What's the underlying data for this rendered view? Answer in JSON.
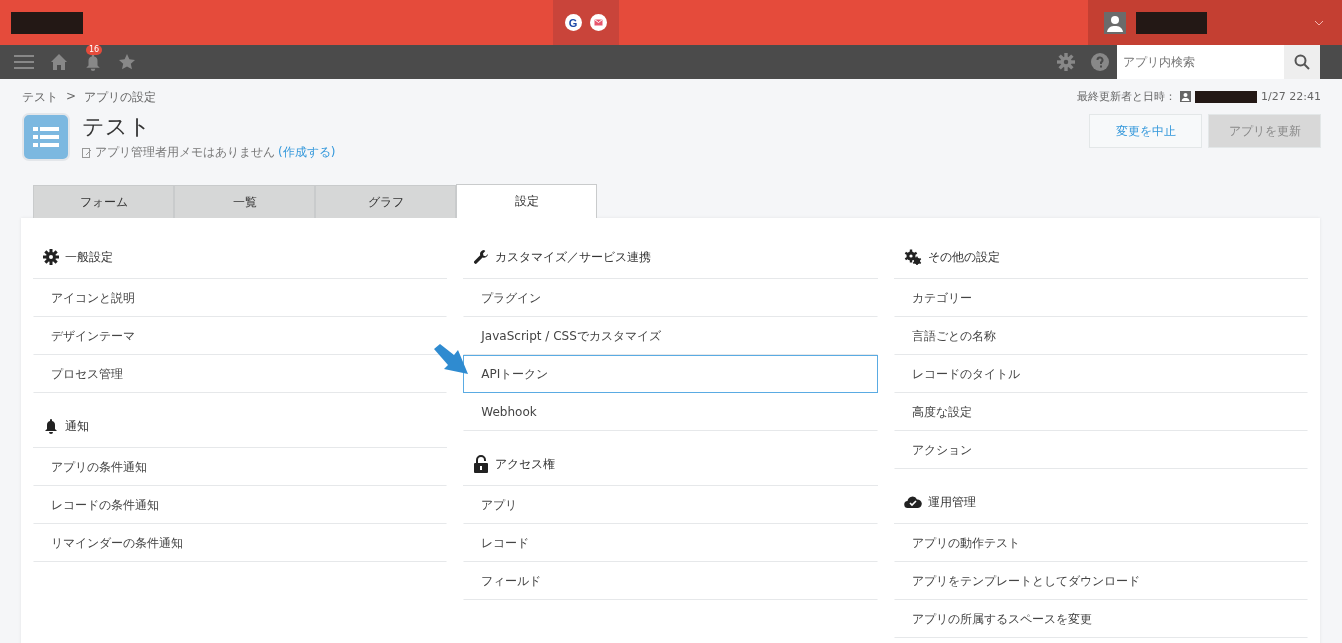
{
  "header": {
    "logo_redacted": true,
    "g_badge": "G",
    "user_redacted": true
  },
  "toolbar": {
    "notification_count": "16",
    "search": {
      "placeholder": "アプリ内検索"
    }
  },
  "breadcrumb": [
    "テスト",
    "アプリの設定"
  ],
  "breadcrumb_separator": ">",
  "app": {
    "title": "テスト",
    "memo": "アプリ管理者用メモはありません",
    "memo_link": "(作成する)"
  },
  "last_updated": {
    "label": "最終更新者と日時：",
    "time": "1/27 22:41"
  },
  "buttons": [
    {
      "label": "変更を中止",
      "kind": "secondary"
    },
    {
      "label": "アプリを更新",
      "kind": "disabled"
    }
  ],
  "tabs": [
    {
      "label": "フォーム",
      "selected": false
    },
    {
      "label": "一覧",
      "selected": false
    },
    {
      "label": "グラフ",
      "selected": false
    },
    {
      "label": "設定",
      "selected": true
    }
  ],
  "columns": [
    {
      "sections": [
        {
          "title": "一般設定",
          "items": [
            {
              "label": "アイコンと説明",
              "selected": false
            },
            {
              "label": "デザインテーマ",
              "selected": false
            },
            {
              "label": "プロセス管理",
              "selected": false
            }
          ]
        },
        {
          "title": "通知",
          "items": [
            {
              "label": "アプリの条件通知",
              "selected": false
            },
            {
              "label": "レコードの条件通知",
              "selected": false
            },
            {
              "label": "リマインダーの条件通知",
              "selected": false
            }
          ]
        }
      ]
    },
    {
      "sections": [
        {
          "title": "カスタマイズ／サービス連携",
          "items": [
            {
              "label": "プラグイン",
              "selected": false
            },
            {
              "label": "JavaScript / CSSでカスタマイズ",
              "selected": false
            },
            {
              "label": "APIトークン",
              "selected": true
            },
            {
              "label": "Webhook",
              "selected": false
            }
          ]
        },
        {
          "title": "アクセス権",
          "items": [
            {
              "label": "アプリ",
              "selected": false
            },
            {
              "label": "レコード",
              "selected": false
            },
            {
              "label": "フィールド",
              "selected": false
            }
          ]
        }
      ]
    },
    {
      "sections": [
        {
          "title": "その他の設定",
          "items": [
            {
              "label": "カテゴリー",
              "selected": false
            },
            {
              "label": "言語ごとの名称",
              "selected": false
            },
            {
              "label": "レコードのタイトル",
              "selected": false
            },
            {
              "label": "高度な設定",
              "selected": false
            },
            {
              "label": "アクション",
              "selected": false
            }
          ]
        },
        {
          "title": "運用管理",
          "items": [
            {
              "label": "アプリの動作テスト",
              "selected": false
            },
            {
              "label": "アプリをテンプレートとしてダウンロード",
              "selected": false
            },
            {
              "label": "アプリの所属するスペースを変更",
              "selected": false
            }
          ]
        }
      ]
    }
  ]
}
